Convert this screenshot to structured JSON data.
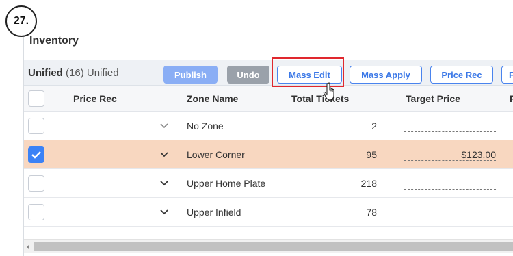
{
  "step_label": "27.",
  "page_title": "Inventory",
  "toolbar": {
    "title_bold": "Unified",
    "title_rest": "(16) Unified",
    "publish_label": "Publish",
    "undo_label": "Undo",
    "mass_edit_label": "Mass Edit",
    "mass_apply_label": "Mass Apply",
    "price_rec_label": "Price Rec",
    "more_label": "F"
  },
  "columns": {
    "price_rec": "Price Rec",
    "zone_name": "Zone Name",
    "total_tickets": "Total Tickets",
    "target_price": "Target Price",
    "next": "F"
  },
  "rows": [
    {
      "zone": "No Zone",
      "tickets": "2",
      "target_price": "",
      "checked": false
    },
    {
      "zone": "Lower Corner",
      "tickets": "95",
      "target_price": "$123.00",
      "checked": true
    },
    {
      "zone": "Upper Home Plate",
      "tickets": "218",
      "target_price": "",
      "checked": false
    },
    {
      "zone": "Upper Infield",
      "tickets": "78",
      "target_price": "",
      "checked": false
    }
  ],
  "colors": {
    "accent": "#3b78e7",
    "selected_row": "#f8d7c0",
    "highlight": "#e0282e"
  },
  "icons": [
    "chevron-down-icon",
    "checkmark-icon",
    "hand-pointer-icon",
    "scroll-left-arrow-icon"
  ]
}
